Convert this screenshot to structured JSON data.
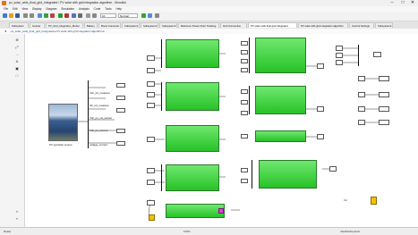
{
  "window": {
    "title": "pv_solar_cells_final_grid_Integrated / PV solar with grid integration algorithm - Simulink",
    "controls": {
      "minimize": "–",
      "maximize": "□",
      "close": "✕"
    }
  },
  "menu": [
    "File",
    "Edit",
    "View",
    "Display",
    "Diagram",
    "Simulation",
    "Analysis",
    "Code",
    "Tools",
    "Help"
  ],
  "toolbar": {
    "stop_time": "10",
    "mode": "Normal"
  },
  "tabs": [
    {
      "label": "Subsystem"
    },
    {
      "label": "Inverter"
    },
    {
      "label": "PV_Grid_Integration_Model"
    },
    {
      "label": "Battery"
    },
    {
      "label": "Boost Converter"
    },
    {
      "label": "Subsystem1"
    },
    {
      "label": "Subsystem2"
    },
    {
      "label": "Subsystem3"
    },
    {
      "label": "Maximum Power Point Tracking"
    },
    {
      "label": "Grid Connection"
    },
    {
      "label": "PV solar cells final grid Integrated"
    },
    {
      "label": "PV solar with grid integration algorithm"
    },
    {
      "label": "Control Settings"
    },
    {
      "label": "Subsystem4"
    }
  ],
  "address": {
    "path": "pv_solar_cells_final_grid_Integrated ▸ PV solar with grid integration algorithm ▸"
  },
  "canvas": {
    "pv_label": "PV synthetic source",
    "signal_labels": [
      "Vdc_ref_measure",
      "Idc_ref_measure",
      "Vdc_pv_vol_sensor",
      "Vdc_pv_current",
      "voltage_current"
    ],
    "port_block_label": "Ref"
  },
  "status": {
    "left": "Ready",
    "center": "100%",
    "right": "VariableStepAuto"
  },
  "colors": {
    "block_green": "#3ad23a",
    "canvas_bg": "#ffffff",
    "scope_yellow": "#f2c400",
    "terminator_magenta": "#e040e0"
  }
}
